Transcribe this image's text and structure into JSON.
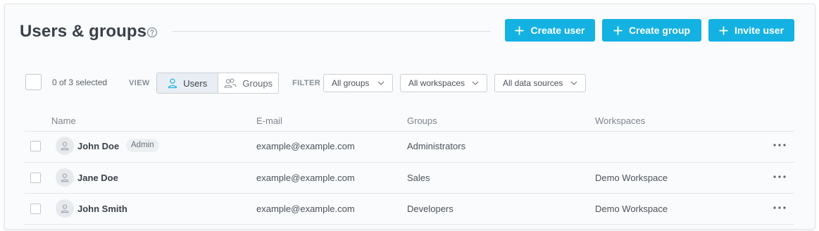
{
  "header": {
    "title": "Users & groups",
    "help_icon": "question-circle-icon",
    "buttons": {
      "create_user": "Create user",
      "create_group": "Create group",
      "invite_user": "Invite user"
    },
    "button_color": "#14b2e2"
  },
  "toolbar": {
    "selected_count": "0 of 3 selected",
    "view_label": "VIEW",
    "view_users": "Users",
    "view_groups": "Groups",
    "view_selected": "Users",
    "filter_label": "FILTER",
    "filter_groups": "All groups",
    "filter_workspaces": "All workspaces",
    "filter_data_sources": "All data sources"
  },
  "table": {
    "columns": {
      "name": "Name",
      "email": "E-mail",
      "groups": "Groups",
      "workspaces": "Workspaces"
    },
    "rows": [
      {
        "name": "John Doe",
        "badge": "Admin",
        "email": "example@example.com",
        "groups": "Administrators",
        "workspaces": ""
      },
      {
        "name": "Jane Doe",
        "email": "example@example.com",
        "groups": "Sales",
        "workspaces": "Demo Workspace"
      },
      {
        "name": "John Smith",
        "email": "example@example.com",
        "groups": "Developers",
        "workspaces": "Demo Workspace"
      }
    ]
  }
}
